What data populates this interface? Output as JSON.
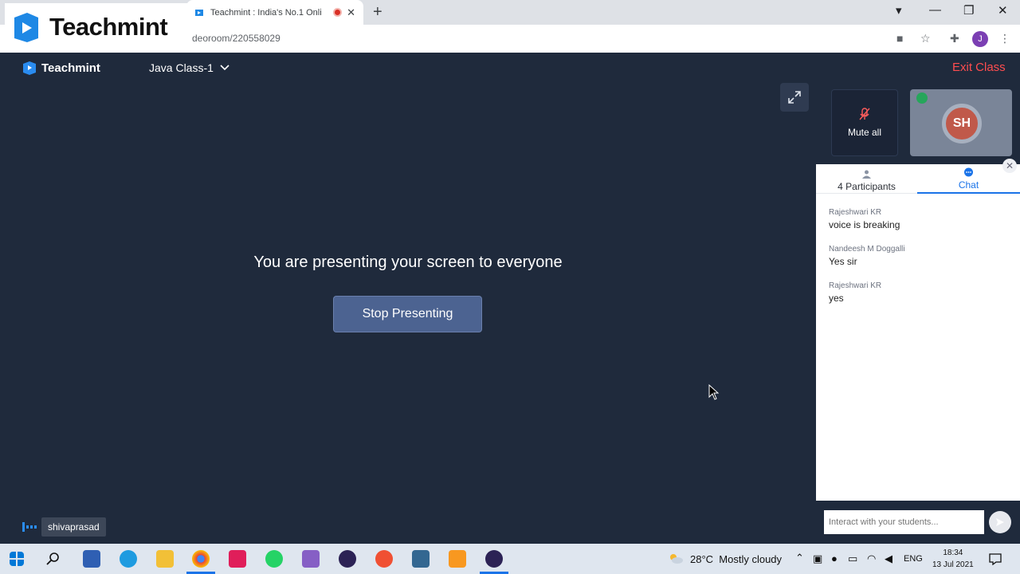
{
  "brand": {
    "logo_text": "Teachmint"
  },
  "browser": {
    "tab_title": "Teachmint : India's No.1 Onli",
    "url": "deoroom/220558029",
    "profile_initial": "J"
  },
  "header": {
    "logo_text": "Teachmint",
    "class_name": "Java Class-1",
    "exit_label": "Exit Class"
  },
  "stage": {
    "message": "You are presenting your screen to everyone",
    "stop_label": "Stop Presenting"
  },
  "tiles": {
    "mute_all_label": "Mute all",
    "participant_initials": "SH"
  },
  "panel": {
    "participants_count": "4",
    "participants_label": "Participants",
    "chat_label": "Chat",
    "messages": [
      {
        "sender": "Rajeshwari KR",
        "text": "voice is breaking"
      },
      {
        "sender": "Nandeesh M Doggalli",
        "text": "Yes sir"
      },
      {
        "sender": "Rajeshwari KR",
        "text": "yes"
      }
    ],
    "input_placeholder": "Interact with your students..."
  },
  "presenter": {
    "name": "shivaprasad"
  },
  "taskbar": {
    "temperature": "28°C",
    "weather": "Mostly cloudy",
    "language": "ENG",
    "time": "18:34",
    "date": "13 Jul 2021"
  },
  "colors": {
    "accent": "#1a73e8",
    "exit": "#ff4d4f",
    "stage": "#1f2a3c",
    "button": "#4c6391"
  }
}
